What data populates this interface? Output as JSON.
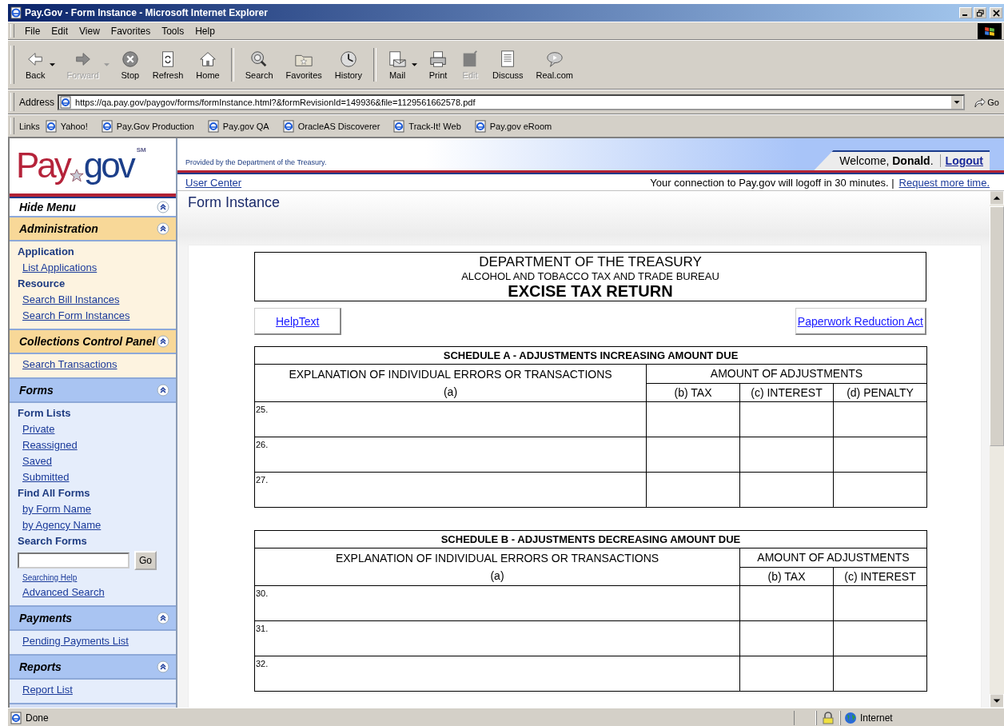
{
  "window": {
    "title": "Pay.Gov - Form Instance - Microsoft Internet Explorer"
  },
  "menu": [
    "File",
    "Edit",
    "View",
    "Favorites",
    "Tools",
    "Help"
  ],
  "toolbar": [
    [
      {
        "kind": "back",
        "label": "Back",
        "disabled": false,
        "dropdown": true
      },
      {
        "kind": "forward",
        "label": "Forward",
        "disabled": true,
        "dropdown": true
      },
      {
        "kind": "stop",
        "label": "Stop",
        "disabled": false,
        "dropdown": false
      },
      {
        "kind": "refresh",
        "label": "Refresh",
        "disabled": false,
        "dropdown": false
      },
      {
        "kind": "home",
        "label": "Home",
        "disabled": false,
        "dropdown": false
      }
    ],
    [
      {
        "kind": "search",
        "label": "Search",
        "disabled": false,
        "dropdown": false
      },
      {
        "kind": "favorites",
        "label": "Favorites",
        "disabled": false,
        "dropdown": false
      },
      {
        "kind": "history",
        "label": "History",
        "disabled": false,
        "dropdown": false
      }
    ],
    [
      {
        "kind": "mail",
        "label": "Mail",
        "disabled": false,
        "dropdown": true
      },
      {
        "kind": "print",
        "label": "Print",
        "disabled": false,
        "dropdown": false
      },
      {
        "kind": "edit",
        "label": "Edit",
        "disabled": true,
        "dropdown": false
      },
      {
        "kind": "discuss",
        "label": "Discuss",
        "disabled": false,
        "dropdown": false
      },
      {
        "kind": "real",
        "label": "Real.com",
        "disabled": false,
        "dropdown": false
      }
    ]
  ],
  "address": {
    "label": "Address",
    "value": "https://qa.pay.gov/paygov/forms/formInstance.html?&formRevisionId=149936&file=1129561662578.pdf",
    "go": "Go"
  },
  "links": {
    "label": "Links",
    "items": [
      "Yahoo!",
      "Pay.Gov Production",
      "Pay.gov QA",
      "OracleAS Discoverer",
      "Track-It! Web",
      "Pay.gov eRoom"
    ]
  },
  "site": {
    "logo": {
      "first": "Pay",
      "second": "gov",
      "mark": "SM"
    },
    "provided": "Provided by the Department of the Treasury.",
    "welcome": "Welcome, **Donald**.",
    "logout": "Logout",
    "user_center": "User Center",
    "session": "Your connection to Pay.gov will logoff in 30 minutes. |",
    "request": "Request more time."
  },
  "sidebar": {
    "hide": {
      "label": "Hide Menu",
      "expanded": true
    },
    "sections": [
      {
        "title": "Administration",
        "color": "#f8d898",
        "expanded": true,
        "items": [
          {
            "kind": "heading",
            "text": "Application"
          },
          {
            "kind": "link",
            "text": "List Applications"
          },
          {
            "kind": "heading",
            "text": "Resource"
          },
          {
            "kind": "link",
            "text": "Search Bill Instances"
          },
          {
            "kind": "link",
            "text": "Search Form Instances"
          }
        ]
      },
      {
        "title": "Collections Control Panel",
        "color": "#f8d898",
        "expanded": true,
        "items": [
          {
            "kind": "link",
            "text": "Search Transactions"
          }
        ]
      },
      {
        "title": "Forms",
        "color": "#a9c4f2",
        "expanded": true,
        "items": [
          {
            "kind": "heading",
            "text": "Form Lists"
          },
          {
            "kind": "link",
            "text": "Private"
          },
          {
            "kind": "link",
            "text": "Reassigned"
          },
          {
            "kind": "link",
            "text": "Saved"
          },
          {
            "kind": "link",
            "text": "Submitted"
          },
          {
            "kind": "heading",
            "text": "Find All Forms"
          },
          {
            "kind": "link",
            "text": "by Form Name"
          },
          {
            "kind": "link",
            "text": "by Agency Name"
          },
          {
            "kind": "heading",
            "text": "Search Forms"
          },
          {
            "kind": "search",
            "text": "Go"
          },
          {
            "kind": "small-link",
            "text": "Searching Help"
          },
          {
            "kind": "link",
            "text": "Advanced Search"
          }
        ]
      },
      {
        "title": "Payments",
        "color": "#a9c4f2",
        "expanded": true,
        "items": [
          {
            "kind": "link",
            "text": "Pending Payments List"
          }
        ]
      },
      {
        "title": "Reports",
        "color": "#a9c4f2",
        "expanded": true,
        "items": [
          {
            "kind": "link",
            "text": "Report List"
          }
        ]
      }
    ]
  },
  "page_title": "Form Instance",
  "form": {
    "header": [
      {
        "kind": "agency",
        "text": "DEPARTMENT OF THE TREASURY"
      },
      {
        "kind": "bureau",
        "text": "ALCOHOL AND TOBACCO TAX AND TRADE BUREAU"
      },
      {
        "kind": "form",
        "text": "EXCISE TAX RETURN"
      }
    ],
    "buttons": [
      "HelpText",
      "Paperwork Reduction Act"
    ],
    "schedules": [
      {
        "title": "SCHEDULE A - ADJUSTMENTS INCREASING AMOUNT DUE",
        "explanation": "EXPLANATION OF INDIVIDUAL ERRORS OR TRANSACTIONS",
        "explanation_sub": "(a)",
        "amount": "AMOUNT OF ADJUSTMENTS",
        "columns": [
          "(b) TAX",
          "(c) INTEREST",
          "(d) PENALTY"
        ],
        "rows": [
          "25.",
          "26.",
          "27."
        ]
      },
      {
        "title": "SCHEDULE B - ADJUSTMENTS DECREASING AMOUNT DUE",
        "explanation": "EXPLANATION OF INDIVIDUAL ERRORS OR TRANSACTIONS",
        "explanation_sub": "(a)",
        "amount": "AMOUNT OF ADJUSTMENTS",
        "columns": [
          "(b) TAX",
          "(c) INTEREST"
        ],
        "rows": [
          "30.",
          "31.",
          "32."
        ]
      }
    ]
  },
  "status_bar": {
    "text": "Done",
    "zone": "Internet"
  }
}
